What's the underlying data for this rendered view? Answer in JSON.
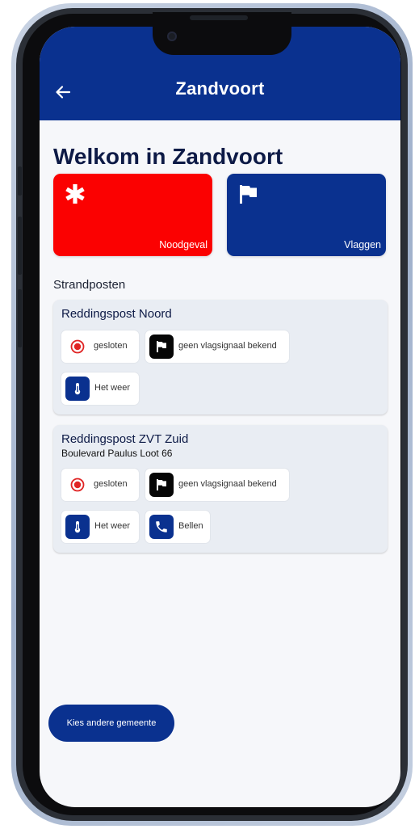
{
  "header": {
    "title": "Zandvoort"
  },
  "welcome": "Welkom in Zandvoort",
  "tiles": [
    {
      "label": "Noodgeval",
      "icon": "asterisk-icon",
      "color": "#fb0101"
    },
    {
      "label": "Vlaggen",
      "icon": "flag-icon",
      "color": "#0a318f"
    }
  ],
  "section_title": "Strandposten",
  "posts": [
    {
      "name": "Reddingspost Noord",
      "status": "gesloten",
      "flag": "geen vlagsignaal bekend",
      "weather": "Het weer"
    },
    {
      "name": "Reddingspost ZVT Zuid",
      "address": "Boulevard Paulus Loot 66",
      "status": "gesloten",
      "flag": "geen vlagsignaal bekend",
      "weather": "Het weer",
      "call": "Bellen"
    }
  ],
  "cta": "Kies andere gemeente",
  "colors": {
    "primary": "#0a318f",
    "emergency": "#fb0101",
    "status_closed": "#e02424"
  }
}
